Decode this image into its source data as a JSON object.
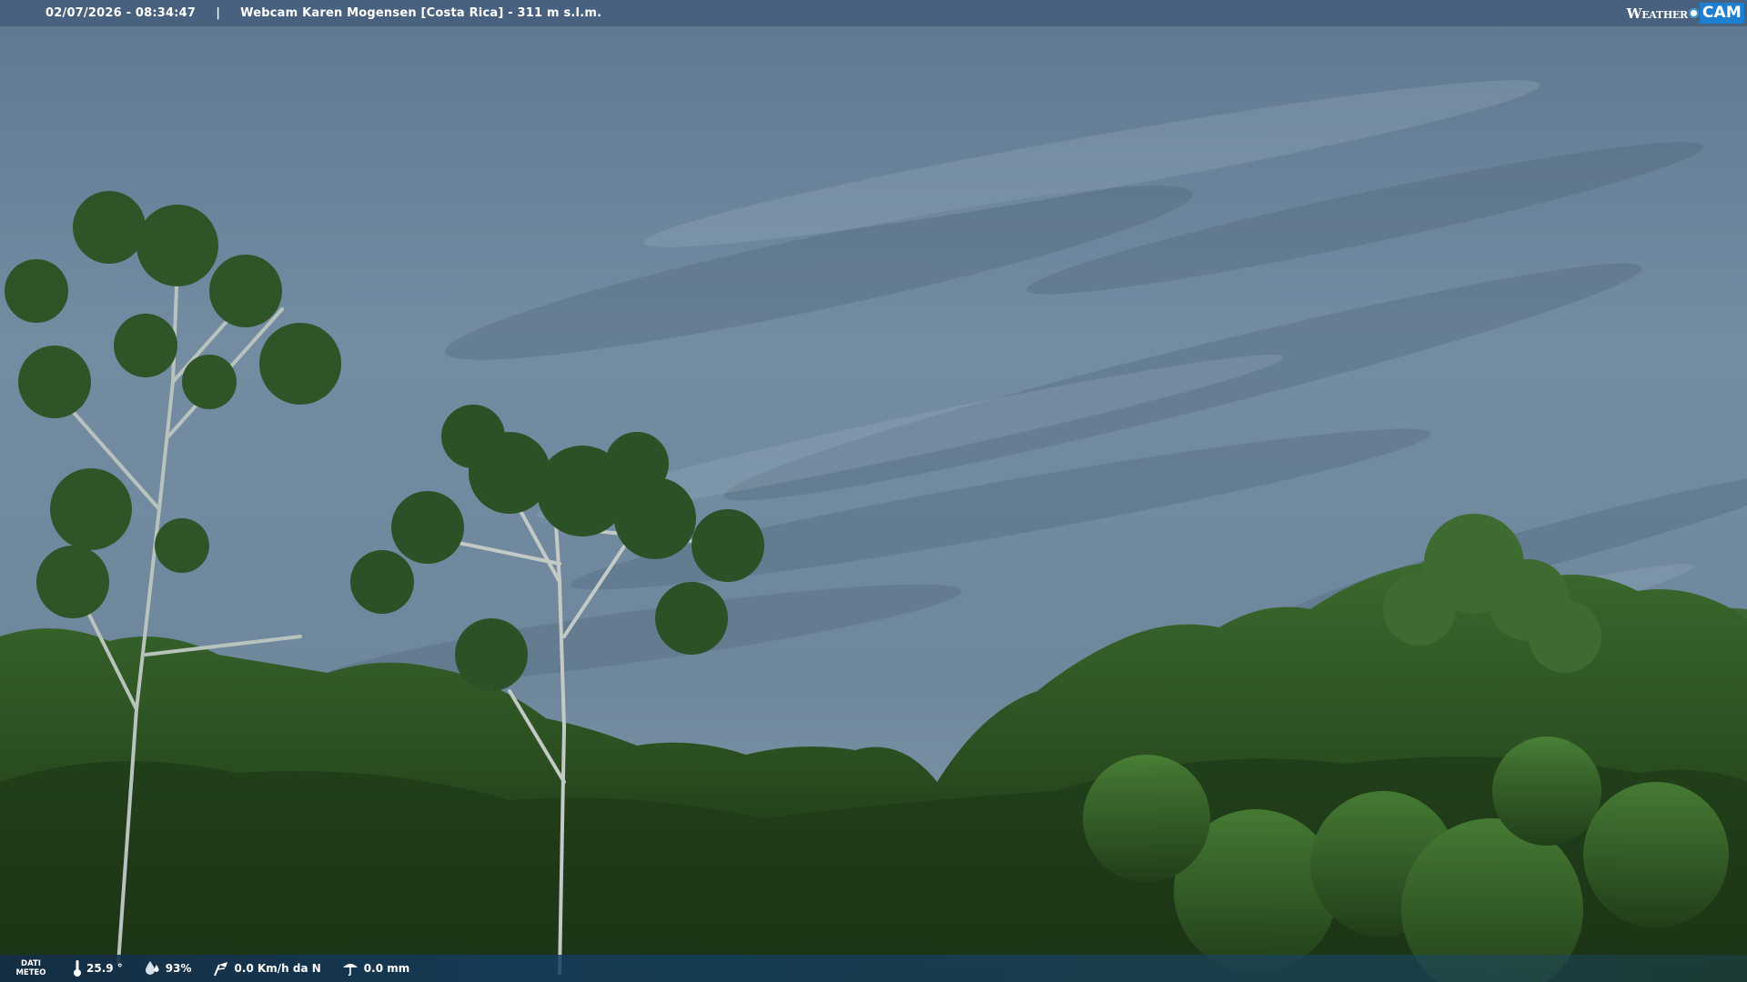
{
  "overlay": {
    "timestamp": "02/07/2026 - 08:34:47",
    "separator": "|",
    "camera_title": "Webcam Karen Mogensen [Costa Rica]  - 311 m s.l.m.",
    "logo": {
      "weather_text": "Weather",
      "cam_text": "CAM",
      "accent_color": "#1e7fd0"
    }
  },
  "weather_bar": {
    "label_line1": "DATI",
    "label_line2": "METEO",
    "temperature": "25.9 °",
    "humidity": "93%",
    "wind": "0.0 Km/h da N",
    "rain": "0.0 mm",
    "icons": [
      "thermometer-icon",
      "humidity-icon",
      "wind-icon",
      "rain-icon"
    ]
  },
  "scene": {
    "sky_color": "#6d8498",
    "forest_color": "#2a4a22"
  }
}
